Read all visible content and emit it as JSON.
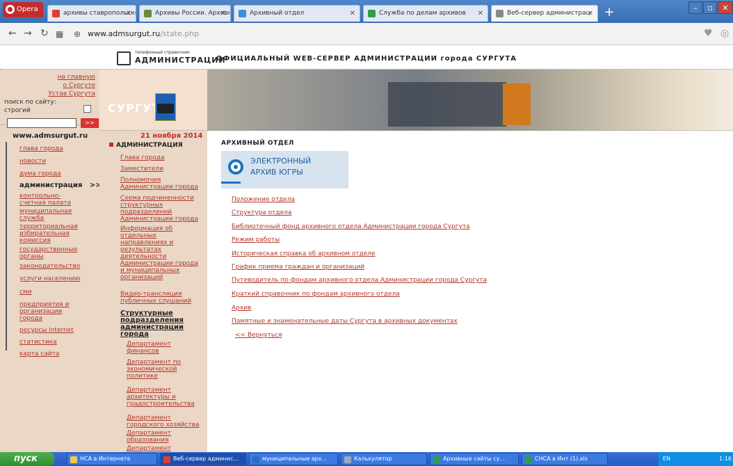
{
  "browser": {
    "opera_label": "Opera",
    "tabs": [
      {
        "label": "архивы ставропольского",
        "icon": "yandex-icon",
        "color": "#e23b2f"
      },
      {
        "label": "Архивы России. Архивные",
        "icon": "archives-icon",
        "color": "#6a8a3a"
      },
      {
        "label": "Архивный отдел",
        "icon": "page-icon",
        "color": "#3a8fd6"
      },
      {
        "label": "Служба по делам архивов",
        "icon": "page-icon",
        "color": "#2e9e46"
      },
      {
        "label": "Веб-сервер администрац",
        "icon": "page-icon",
        "color": "#888888"
      }
    ],
    "url_domain": "www.admsurgut.ru",
    "url_path": "/state.php"
  },
  "site": {
    "phone_small": "телефонный справочник",
    "phone_big": "АДМИНИСТРАЦИИ",
    "title": "ОФИЦИАЛЬНЫЙ WEB-СЕРВЕР АДМИНИСТРАЦИИ города СУРГУТА",
    "logo_text": "СУРГУТ"
  },
  "quick": {
    "home": "на главную",
    "about": "о Сургуте",
    "charter": "Устав Сургута",
    "search_label": "поиск по сайту:",
    "strict_label": "строгий",
    "search_btn": ">>"
  },
  "left": {
    "site_url": "www.admsurgut.ru",
    "items": [
      "глава города",
      "новости",
      "дума города",
      "администрация   >>",
      "контрольно-счетная палата",
      "муниципальная служба",
      "территориальная избирательная комиссия",
      "государственные органы",
      "законодательство",
      "услуги населению",
      "сми",
      "предприятия и организации города",
      "ресурсы internet",
      "статистика",
      "карта сайта"
    ]
  },
  "mid": {
    "date": "21 ноября 2014",
    "heading": "АДМИНИСТРАЦИЯ",
    "items": [
      "Глава города",
      "Заместители",
      "Полномочия Администрации города",
      "Схема подчиненности структурных подразделений Администрации города",
      "Информация об отдельных направлениях и результатах деятельности Администрации города и муниципальных организаций",
      "Видео-трансляция публичных слушаний"
    ],
    "struct": "Структурные подразделения администрации города",
    "subs": [
      "Департамент финансов",
      "Департамент по экономической политике",
      "Департамент архитектуры и градостроительства",
      "Департамент городского хозяйства",
      "Департамент образования",
      "Департамент"
    ]
  },
  "content": {
    "title": "АРХИВНЫЙ ОТДЕЛ",
    "earchive_line1": "ЭЛЕКТРОННЫЙ",
    "earchive_line2": "АРХИВ ЮГРЫ",
    "links": [
      "Положение отдела",
      "Структура отдела",
      "Библиотечный фонд архивного отдела Администрации города Сургута",
      "Режим работы",
      "Историческая справка об архивном отделе",
      "График приема граждан и организаций",
      "Путеводитель по фондам архивного отдела Администрации города Сургута",
      "Краткий справочник по фондам архивного отдела",
      "Архив",
      "Памятные и знаменательные даты Сургута в архивных документах"
    ],
    "back": "<< Вернуться"
  },
  "taskbar": {
    "start": "пуск",
    "items": [
      "НСА в Интернете",
      "Веб-сервер админис...",
      "муниципальные арх...",
      "Калькулятор",
      "Архивные сайты су...",
      "СНСА в Инт (1).xls"
    ],
    "tray": "EN",
    "clock": "1:16"
  }
}
